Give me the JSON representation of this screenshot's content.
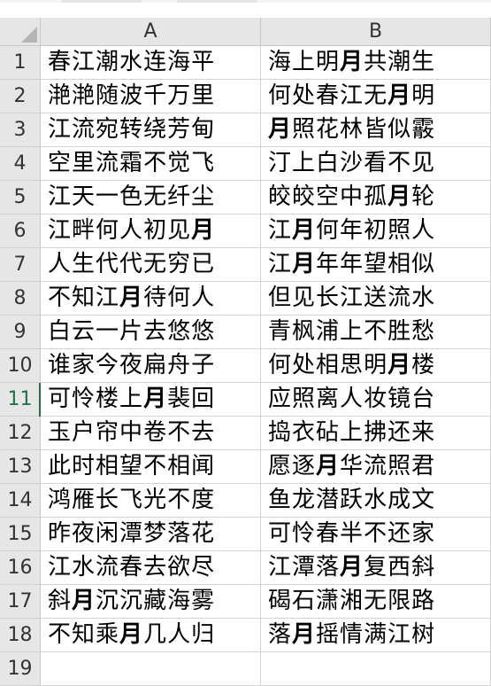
{
  "sheet": {
    "columns": [
      "A",
      "B"
    ],
    "selected_row": 11,
    "bold_char": "月",
    "rows": [
      {
        "num": "1",
        "a": "春江潮水连海平",
        "b": "海上明月共潮生"
      },
      {
        "num": "2",
        "a": "滟滟随波千万里",
        "b": "何处春江无月明"
      },
      {
        "num": "3",
        "a": "江流宛转绕芳甸",
        "b": "月照花林皆似霰"
      },
      {
        "num": "4",
        "a": "空里流霜不觉飞",
        "b": "汀上白沙看不见"
      },
      {
        "num": "5",
        "a": "江天一色无纤尘",
        "b": "皎皎空中孤月轮"
      },
      {
        "num": "6",
        "a": "江畔何人初见月",
        "b": "江月何年初照人"
      },
      {
        "num": "7",
        "a": "人生代代无穷已",
        "b": "江月年年望相似"
      },
      {
        "num": "8",
        "a": "不知江月待何人",
        "b": "但见长江送流水"
      },
      {
        "num": "9",
        "a": "白云一片去悠悠",
        "b": "青枫浦上不胜愁"
      },
      {
        "num": "10",
        "a": "谁家今夜扁舟子",
        "b": "何处相思明月楼"
      },
      {
        "num": "11",
        "a": "可怜楼上月裴回",
        "b": "应照离人妆镜台"
      },
      {
        "num": "12",
        "a": "玉户帘中卷不去",
        "b": "捣衣砧上拂还来"
      },
      {
        "num": "13",
        "a": "此时相望不相闻",
        "b": "愿逐月华流照君"
      },
      {
        "num": "14",
        "a": "鸿雁长飞光不度",
        "b": "鱼龙潜跃水成文"
      },
      {
        "num": "15",
        "a": "昨夜闲潭梦落花",
        "b": "可怜春半不还家"
      },
      {
        "num": "16",
        "a": "江水流春去欲尽",
        "b": "江潭落月复西斜"
      },
      {
        "num": "17",
        "a": "斜月沉沉藏海雾",
        "b": "碣石潇湘无限路"
      },
      {
        "num": "18",
        "a": "不知乘月几人归",
        "b": "落月摇情满江树"
      },
      {
        "num": "19",
        "a": "",
        "b": ""
      }
    ]
  }
}
